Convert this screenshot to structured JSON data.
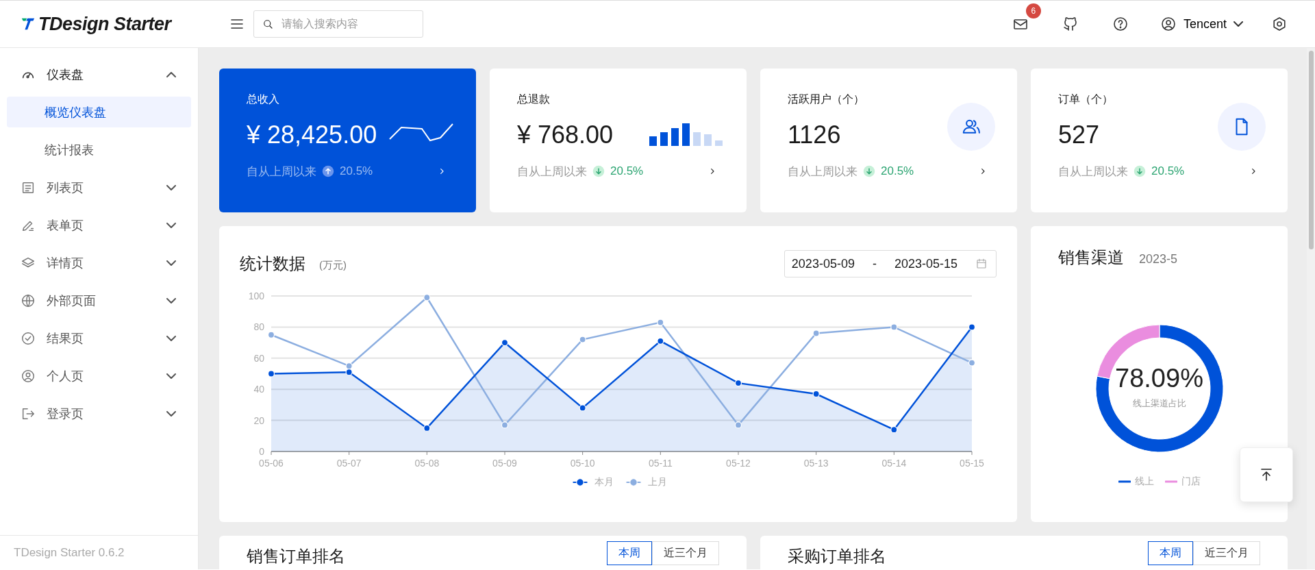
{
  "header": {
    "logo": "TDesign Starter",
    "search": {
      "placeholder": "请输入搜索内容"
    },
    "notification_count": "6",
    "user": "Tencent"
  },
  "sidebar": {
    "items": [
      {
        "label": "仪表盘",
        "expanded": true,
        "children": [
          {
            "label": "概览仪表盘",
            "selected": true
          },
          {
            "label": "统计报表",
            "selected": false
          }
        ]
      },
      {
        "label": "列表页",
        "expanded": false
      },
      {
        "label": "表单页",
        "expanded": false
      },
      {
        "label": "详情页",
        "expanded": false
      },
      {
        "label": "外部页面",
        "expanded": false
      },
      {
        "label": "结果页",
        "expanded": false
      },
      {
        "label": "个人页",
        "expanded": false
      },
      {
        "label": "登录页",
        "expanded": false
      }
    ],
    "footer": "TDesign Starter 0.6.2"
  },
  "stat_cards": [
    {
      "kind": "line",
      "highlight": true,
      "title": "总收入",
      "value": "¥ 28,425.00",
      "trend_label": "自从上周以来",
      "trend": "20.5%",
      "trend_up": true
    },
    {
      "kind": "bar",
      "highlight": false,
      "title": "总退款",
      "value": "¥ 768.00",
      "trend_label": "自从上周以来",
      "trend": "20.5%",
      "trend_up": false
    },
    {
      "kind": "user",
      "highlight": false,
      "title": "活跃用户（个）",
      "value": "1126",
      "trend_label": "自从上周以来",
      "trend": "20.5%",
      "trend_up": false
    },
    {
      "kind": "file",
      "highlight": false,
      "title": "订单（个）",
      "value": "527",
      "trend_label": "自从上周以来",
      "trend": "20.5%",
      "trend_up": false
    }
  ],
  "stats_panel": {
    "title": "统计数据",
    "unit": "(万元)",
    "date_range": {
      "start": "2023-05-09",
      "separator": "-",
      "end": "2023-05-15"
    },
    "chart_data": {
      "type": "line",
      "categories": [
        "05-06",
        "05-07",
        "05-08",
        "05-09",
        "05-10",
        "05-11",
        "05-12",
        "05-13",
        "05-14",
        "05-15"
      ],
      "series": [
        {
          "name": "本月",
          "color": "#0052d9",
          "type": "area",
          "marker": "circle",
          "values": [
            50,
            51,
            15,
            70,
            28,
            71,
            44,
            37,
            14,
            80
          ]
        },
        {
          "name": "上月",
          "color": "#8caee0",
          "type": "line",
          "marker": "circle",
          "values": [
            75,
            55,
            99,
            17,
            72,
            83,
            17,
            76,
            80,
            57
          ]
        }
      ],
      "ylim": [
        0,
        100
      ],
      "yticks": [
        0,
        20,
        40,
        60,
        80,
        100
      ],
      "grid": true
    }
  },
  "channel_panel": {
    "title": "销售渠道",
    "period": "2023-5",
    "center_value": "78.09%",
    "center_label": "线上渠道占比",
    "chart_data": {
      "type": "donut",
      "categories": [
        "线上",
        "门店"
      ],
      "values": [
        78.09,
        21.91
      ],
      "colors": [
        "#0052d9",
        "#ea8ddf"
      ]
    }
  },
  "ranking_cards": [
    {
      "title": "销售订单排名",
      "tabs": [
        {
          "label": "本周",
          "selected": true
        },
        {
          "label": "近三个月",
          "selected": false
        }
      ]
    },
    {
      "title": "采购订单排名",
      "tabs": [
        {
          "label": "本周",
          "selected": true
        },
        {
          "label": "近三个月",
          "selected": false
        }
      ]
    }
  ]
}
